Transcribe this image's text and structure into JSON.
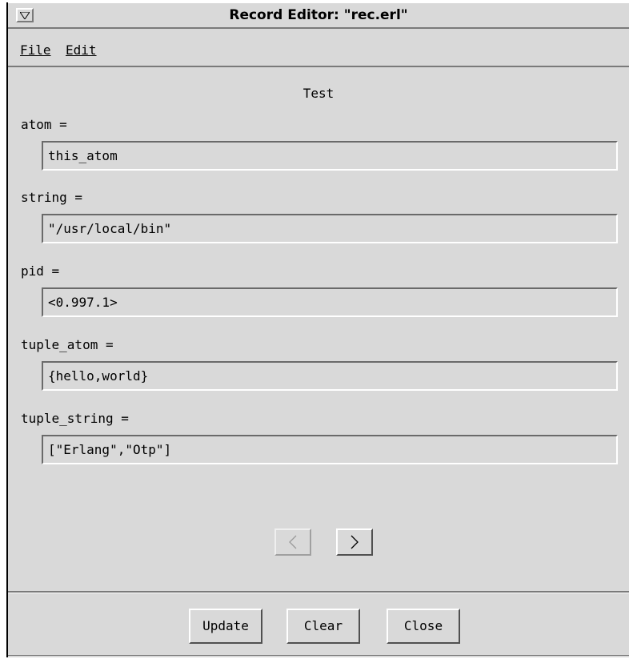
{
  "window": {
    "title": "Record Editor: \"rec.erl\""
  },
  "menubar": {
    "items": [
      "File",
      "Edit"
    ]
  },
  "record": {
    "name": "Test",
    "fields": [
      {
        "label": "atom =",
        "value": "this_atom"
      },
      {
        "label": "string =",
        "value": "\"/usr/local/bin\""
      },
      {
        "label": "pid =",
        "value": "<0.997.1>"
      },
      {
        "label": "tuple_atom =",
        "value": "{hello,world}"
      },
      {
        "label": "tuple_string =",
        "value": "[\"Erlang\",\"Otp\"]"
      }
    ]
  },
  "navigation": {
    "prev_icon": "chevron-left-icon",
    "next_icon": "chevron-right-icon",
    "prev_enabled": false,
    "next_enabled": true
  },
  "buttons": {
    "update_label": "Update",
    "clear_label": "Clear",
    "close_label": "Close"
  },
  "colors": {
    "window_bg": "#d9d9d9",
    "shadow": "#7a7a7a",
    "highlight": "#ffffff"
  }
}
